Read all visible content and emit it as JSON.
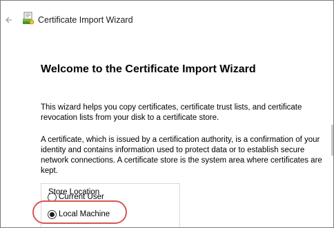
{
  "window": {
    "title": "Certificate Import Wizard",
    "back_icon": "arrow-left-icon",
    "app_icon": "certificate-icon"
  },
  "content": {
    "heading": "Welcome to the Certificate Import Wizard",
    "paragraph1": "This wizard helps you copy certificates, certificate trust lists, and certificate revocation lists from your disk to a certificate store.",
    "paragraph2": "A certificate, which is issued by a certification authority, is a confirmation of your identity and contains information used to protect data or to establish secure network connections. A certificate store is the system area where certificates are kept."
  },
  "store_location": {
    "label": "Store Location",
    "options": [
      {
        "label": "Current User",
        "selected": false
      },
      {
        "label": "Local Machine",
        "selected": true
      }
    ]
  },
  "colors": {
    "highlight": "#d9534f"
  }
}
